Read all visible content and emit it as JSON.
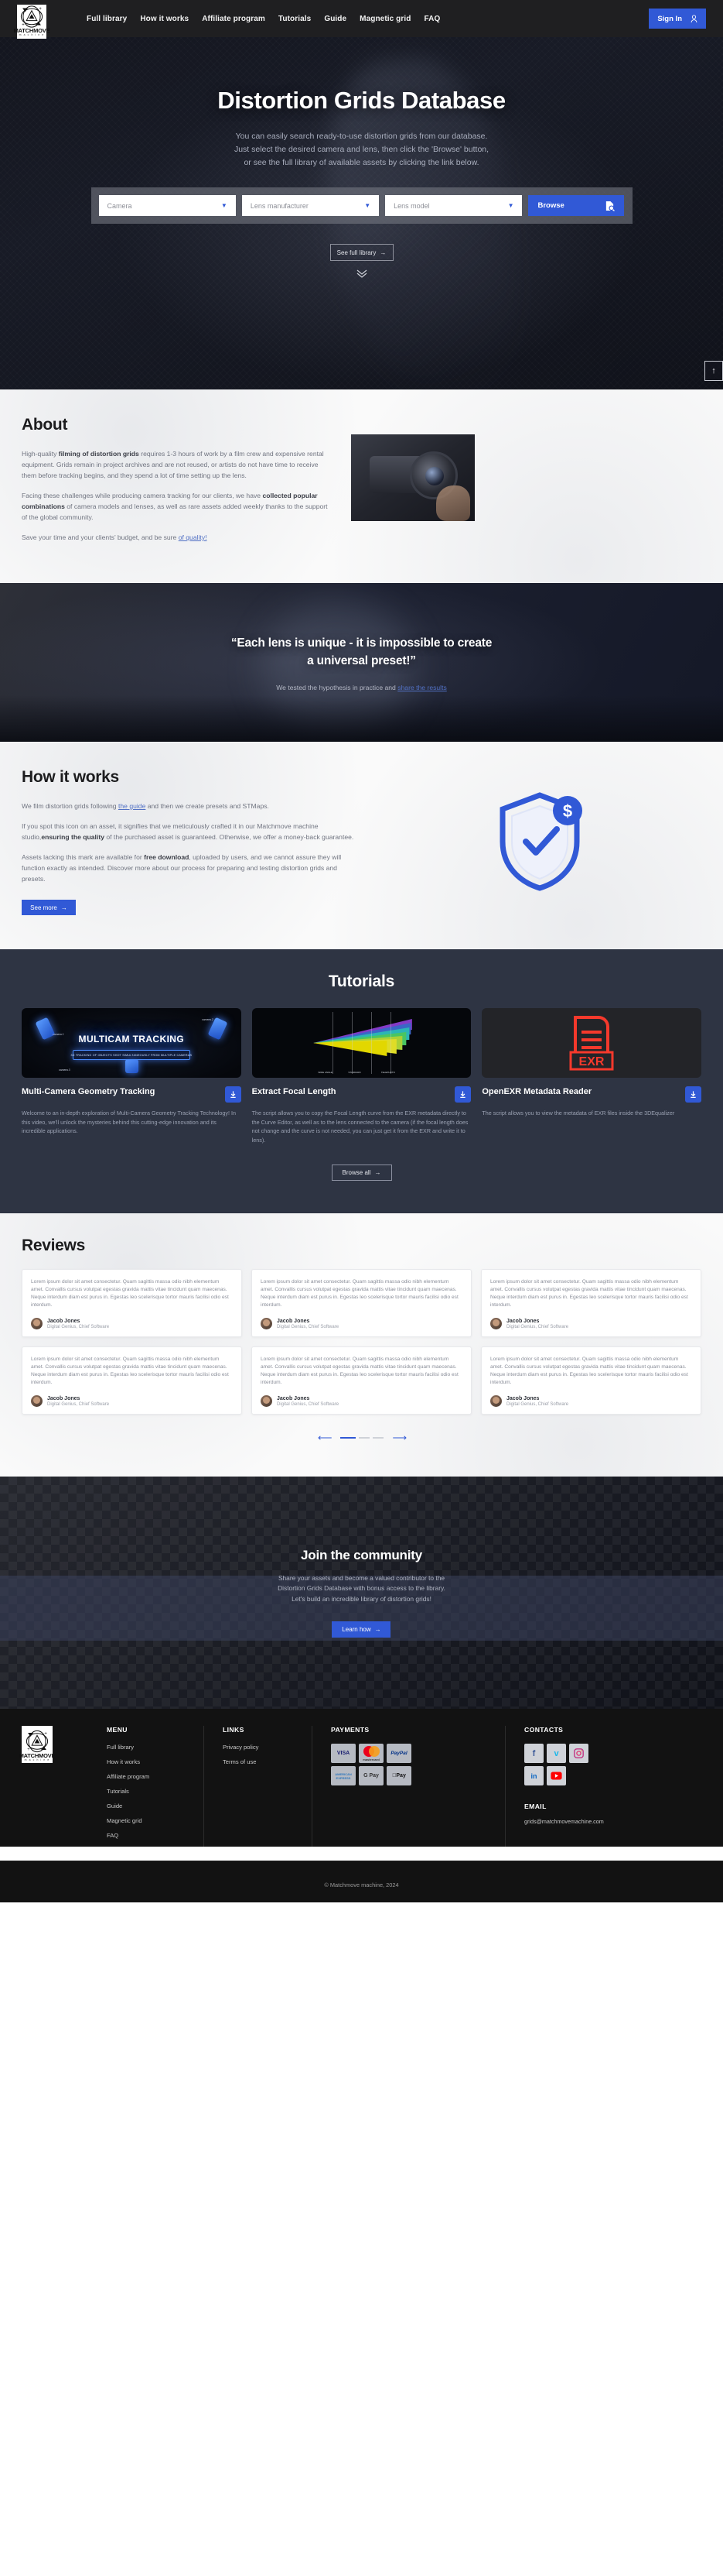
{
  "nav": {
    "logo_word": "MATCHMOVE",
    "logo_sub": "m a c h i n e",
    "links": [
      {
        "label": "Full library"
      },
      {
        "label": "How it works"
      },
      {
        "label": "Affiliate program"
      },
      {
        "label": "Tutorials"
      },
      {
        "label": "Guide"
      },
      {
        "label": "Magnetic grid"
      },
      {
        "label": "FAQ"
      }
    ],
    "signin_label": "Sign In"
  },
  "hero": {
    "title": "Distortion Grids Database",
    "sub_line1": "You can easily search ready-to-use distortion grids from our database.",
    "sub_line2": "Just select the desired camera and lens, then click the 'Browse' button,",
    "sub_line3": "or see the full library of available assets by clicking the link below.",
    "select_camera": "Camera",
    "select_manufacturer": "Lens manufacturer",
    "select_model": "Lens model",
    "browse_label": "Browse",
    "see_full_label": "See full library",
    "arrow": "→",
    "scroll_top": "↑"
  },
  "about": {
    "heading": "About",
    "p1_a": "High-quality ",
    "p1_b": "filming of distortion grids",
    "p1_c": " requires 1-3 hours of work by a film crew and expensive rental equipment. Grids remain in project archives and are not reused, or artists do not have time to receive them before tracking begins, and they spend a lot of time setting up the lens.",
    "p2_a": "Facing these challenges while producing camera tracking for our clients, we have ",
    "p2_b": "collected popular combinations",
    "p2_c": " of camera models and lenses, as well as rare assets added weekly thanks to the support of the global community.",
    "p3_a": "Save your time and your clients’ budget, and be sure ",
    "p3_link": "of quality!"
  },
  "quote": {
    "line1": "“Each lens is unique - it is impossible to create",
    "line2": "a universal preset!”",
    "sub_a": "We tested the hypothesis in practice and ",
    "sub_link": "share the results"
  },
  "how_it_works": {
    "heading": "How it works",
    "p1_a": "We film distortion grids following ",
    "p1_link": "the guide",
    "p1_b": " and then we create presets and STMaps.",
    "p2_a": "If you spot this icon on an asset, it signifies that we meticulously crafted it in our Matchmove machine studio,",
    "p2_b": "ensuring the quality",
    "p2_c": " of the purchased asset is guaranteed. Otherwise, we offer a money-back guarantee.",
    "p3_a": "Assets lacking this mark are available for ",
    "p3_b": "free download",
    "p3_c": ", uploaded by users, and we cannot assure they will function exactly as intended. Discover more about our process for preparing and testing distortion grids and presets.",
    "see_more_label": "See more",
    "arrow": "→"
  },
  "tutorials": {
    "heading": "Tutorials",
    "browse_all_label": "Browse all",
    "arrow": "→",
    "cards": [
      {
        "title": "Multi-Camera Geometry Tracking",
        "desc": "Welcome to an in-depth exploration of Multi-Camera Geometry Tracking Technology! In this video, we'll unlock the mysteries behind this cutting-edge innovation and its incredible applications.",
        "thumb_title": "MULTICAM TRACKING",
        "thumb_sub": "3D TRACKING OF OBJECTS SHOT SIMULTANEOUSLY FROM MULTIPLE CAMERAS",
        "tag1": "camera 1",
        "tag2": "camera 2",
        "tag3": "camera 3"
      },
      {
        "title": "Extract Focal Length",
        "desc": "The script allows you to copy the Focal Length curve from the EXR metadata directly to the Curve Editor, as well as to the lens connected to the camera (if the focal length does not change and the curve is not needed, you can just get it from the EXR and write it to lens).",
        "thumb_label_left": "WIDE ANGLE",
        "thumb_label_mid": "STANDARD",
        "thumb_label_right": "TELEPHOTO"
      },
      {
        "title": "OpenEXR Metadata Reader",
        "desc": "The script allows you to view the metadata of EXR files inside the 3DEqualizer",
        "thumb_label": "EXR"
      }
    ]
  },
  "reviews": {
    "heading": "Reviews",
    "text": "Lorem ipsum dolor sit amet consectetur. Quam sagittis massa odio nibh elementum amet. Convallis cursus volutpat egestas gravida mattis vitae tincidunt quam maecenas. Neque interdum diam est purus in. Egestas leo scelerisque tortor mauris facilisi odio est interdum.",
    "author_name": "Jacob Jones",
    "author_role": "Digital Genius, Chief Software",
    "prev": "⟵",
    "next": "⟶"
  },
  "community": {
    "title": "Join the community",
    "sub_line1": "Share your assets and become a valued contributor to the",
    "sub_line2": "Distortion Grids Database with bonus access to the library.",
    "sub_line3": "Let's build an incredible library of distortion grids!",
    "learn_label": "Learn how",
    "arrow": "→"
  },
  "footer": {
    "logo_word": "MATCHMOVE",
    "logo_sub": "m a c h i n e",
    "menu_head": "MENU",
    "menu_items": [
      {
        "label": "Full library"
      },
      {
        "label": "How it works"
      },
      {
        "label": "Affiliate program"
      },
      {
        "label": "Tutorials"
      },
      {
        "label": "Guide"
      },
      {
        "label": "Magnetic grid"
      },
      {
        "label": "FAQ"
      }
    ],
    "links_head": "LINKS",
    "links_items": [
      {
        "label": "Privacy policy"
      },
      {
        "label": "Terms of use"
      }
    ],
    "payments_head": "PAYMENTS",
    "payments": [
      {
        "label": "VISA"
      },
      {
        "label": "mastercard"
      },
      {
        "label": "PayPal"
      },
      {
        "label": "AMERICAN EXPRESS"
      },
      {
        "label": "G Pay"
      },
      {
        "label": "Pay"
      }
    ],
    "contacts_head": "CONTACTS",
    "socials": [
      {
        "name": "facebook",
        "glyph": "f"
      },
      {
        "name": "vimeo",
        "glyph": "v"
      },
      {
        "name": "instagram",
        "glyph": "▢"
      },
      {
        "name": "linkedin",
        "glyph": "in"
      },
      {
        "name": "youtube",
        "glyph": "▶"
      }
    ],
    "email_head": "EMAIL",
    "email": "grids@matchmovemachine.com",
    "copyright": "© Matchmove machine, 2024"
  },
  "colors": {
    "accent": "#3159d6",
    "dark": "#121212",
    "panel": "#2e3443"
  }
}
